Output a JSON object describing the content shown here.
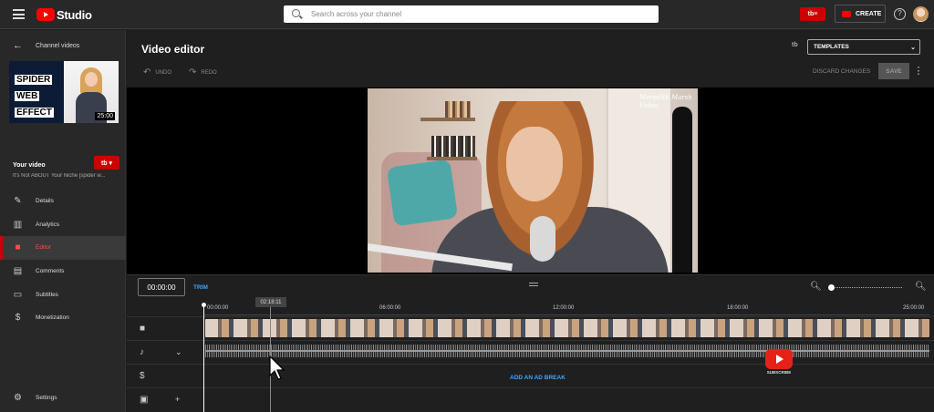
{
  "topbar": {
    "logo_text": "Studio",
    "search_placeholder": "Search across your channel",
    "create_label": "CREATE",
    "help_glyph": "?"
  },
  "sidebar": {
    "back_label": "Channel videos",
    "thumbnail": {
      "words": [
        "SPIDER",
        "WEB",
        "EFFECT"
      ],
      "duration": "25:00"
    },
    "your_video_label": "Your video",
    "video_title": "It's Not ABOUT Your Niche [spider w...",
    "nav_items": [
      {
        "label": "Details",
        "icon": "pencil-icon",
        "active": false
      },
      {
        "label": "Analytics",
        "icon": "analytics-icon",
        "active": false
      },
      {
        "label": "Editor",
        "icon": "editor-icon",
        "active": true
      },
      {
        "label": "Comments",
        "icon": "comments-icon",
        "active": false
      },
      {
        "label": "Subtitles",
        "icon": "subtitles-icon",
        "active": false
      },
      {
        "label": "Monetization",
        "icon": "dollar-icon",
        "active": false
      }
    ],
    "settings_label": "Settings"
  },
  "editor": {
    "title": "Video editor",
    "undo_label": "UNDO",
    "redo_label": "REDO",
    "templates_label": "TEMPLATES",
    "discard_label": "DISCARD CHANGES",
    "save_label": "SAVE",
    "preview_sign": "Meredith Marsh Video"
  },
  "timeline": {
    "timecode": "00:00:00",
    "trim_label": "TRIM",
    "hover_time": "02:18:11",
    "ruler_ticks": [
      "00:00:00",
      "06:00:00",
      "12:00:00",
      "18:00:00",
      "25:00:00"
    ],
    "add_ad_break_label": "ADD AN AD BREAK"
  },
  "overlay": {
    "subscribe_label": "SUBSCRIBE"
  },
  "colors": {
    "accent_red": "#cc0000",
    "link_blue": "#3ea6ff",
    "background": "#1f1f1f"
  }
}
